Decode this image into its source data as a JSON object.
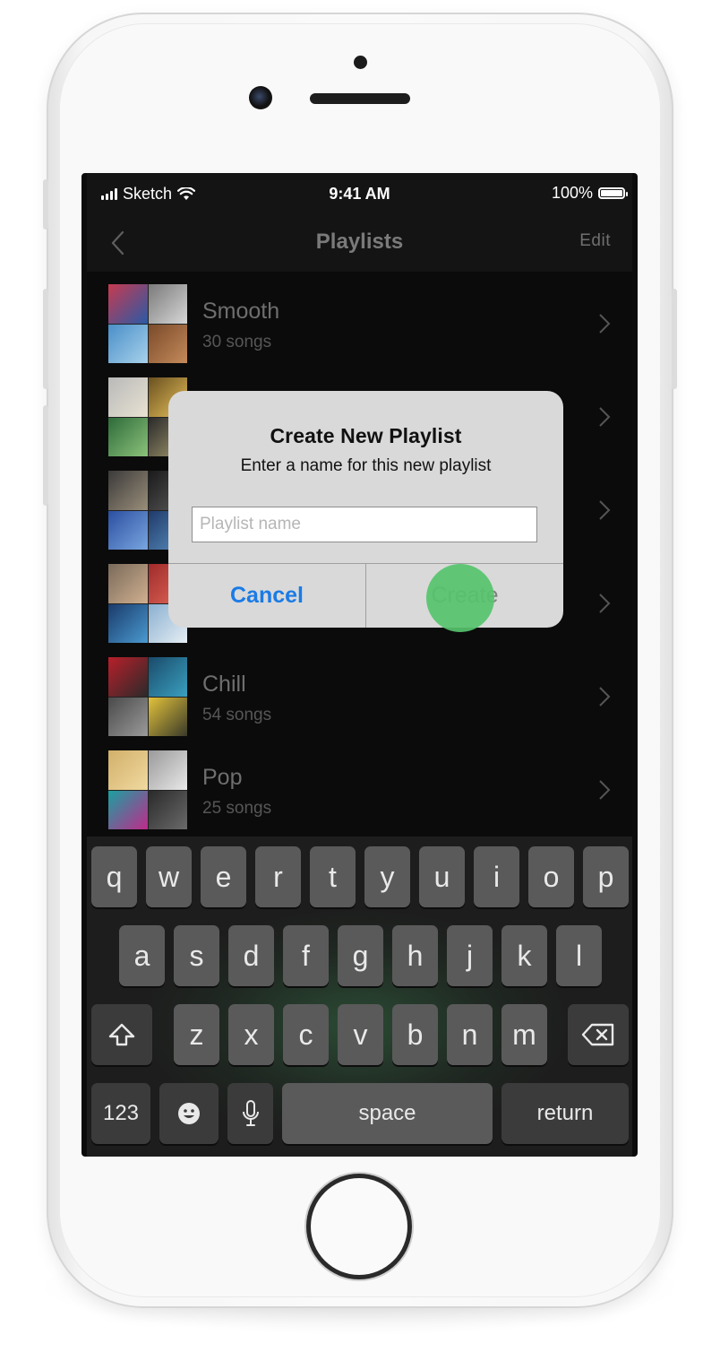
{
  "status_bar": {
    "carrier": "Sketch",
    "time": "9:41 AM",
    "battery": "100%"
  },
  "nav": {
    "title": "Playlists",
    "edit_label": "Edit",
    "back_icon": "chevron-left-icon"
  },
  "playlists": [
    {
      "title": "Smooth",
      "subtitle": "30 songs"
    },
    {
      "title": "",
      "subtitle": ""
    },
    {
      "title": "",
      "subtitle": ""
    },
    {
      "title": "",
      "subtitle": ""
    },
    {
      "title": "Chill",
      "subtitle": "54 songs"
    },
    {
      "title": "Pop",
      "subtitle": "25 songs"
    }
  ],
  "alert": {
    "title": "Create New Playlist",
    "message": "Enter a name for this new playlist",
    "input_value": "",
    "input_placeholder": "Playlist name",
    "cancel_label": "Cancel",
    "create_label": "Create"
  },
  "keyboard": {
    "row1": [
      "q",
      "w",
      "e",
      "r",
      "t",
      "y",
      "u",
      "i",
      "o",
      "p"
    ],
    "row2": [
      "a",
      "s",
      "d",
      "f",
      "g",
      "h",
      "j",
      "k",
      "l"
    ],
    "row3": [
      "z",
      "x",
      "c",
      "v",
      "b",
      "n",
      "m"
    ],
    "numbers_label": "123",
    "space_label": "space",
    "return_label": "return",
    "shift_icon": "shift-icon",
    "delete_icon": "delete-icon",
    "emoji_icon": "emoji-icon",
    "mic_icon": "microphone-icon"
  },
  "colors": {
    "accent_blue": "#1a7be6",
    "touch_indicator": "#56c46e"
  }
}
